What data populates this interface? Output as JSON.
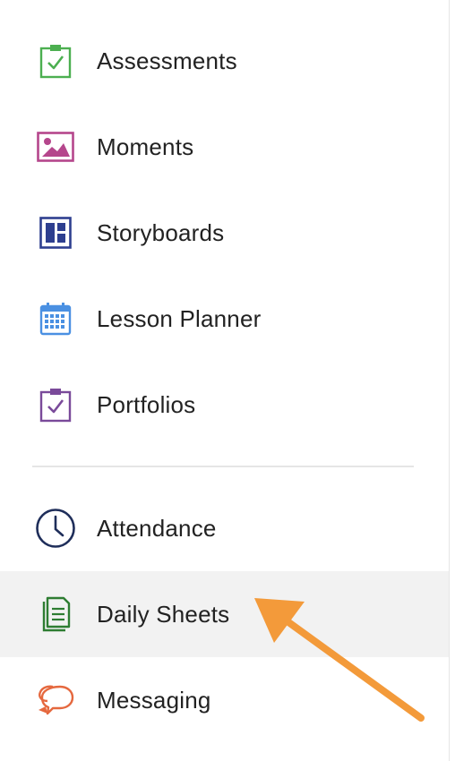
{
  "sidebar": {
    "items": [
      {
        "label": "Assessments",
        "icon": "clipboard-check-icon",
        "color": "#4caf50"
      },
      {
        "label": "Moments",
        "icon": "image-icon",
        "color": "#b5468c"
      },
      {
        "label": "Storyboards",
        "icon": "layout-board-icon",
        "color": "#2e3f8f"
      },
      {
        "label": "Lesson Planner",
        "icon": "calendar-icon",
        "color": "#4a90e2"
      },
      {
        "label": "Portfolios",
        "icon": "clipboard-check-icon",
        "color": "#7a4a9a"
      }
    ],
    "items_secondary": [
      {
        "label": "Attendance",
        "icon": "clock-icon",
        "color": "#1f2e5a"
      },
      {
        "label": "Daily Sheets",
        "icon": "document-stack-icon",
        "color": "#2e7d32",
        "active": true
      },
      {
        "label": "Messaging",
        "icon": "chat-bubbles-icon",
        "color": "#e5683e"
      }
    ]
  },
  "annotation": {
    "arrow_color": "#f39a3a"
  }
}
